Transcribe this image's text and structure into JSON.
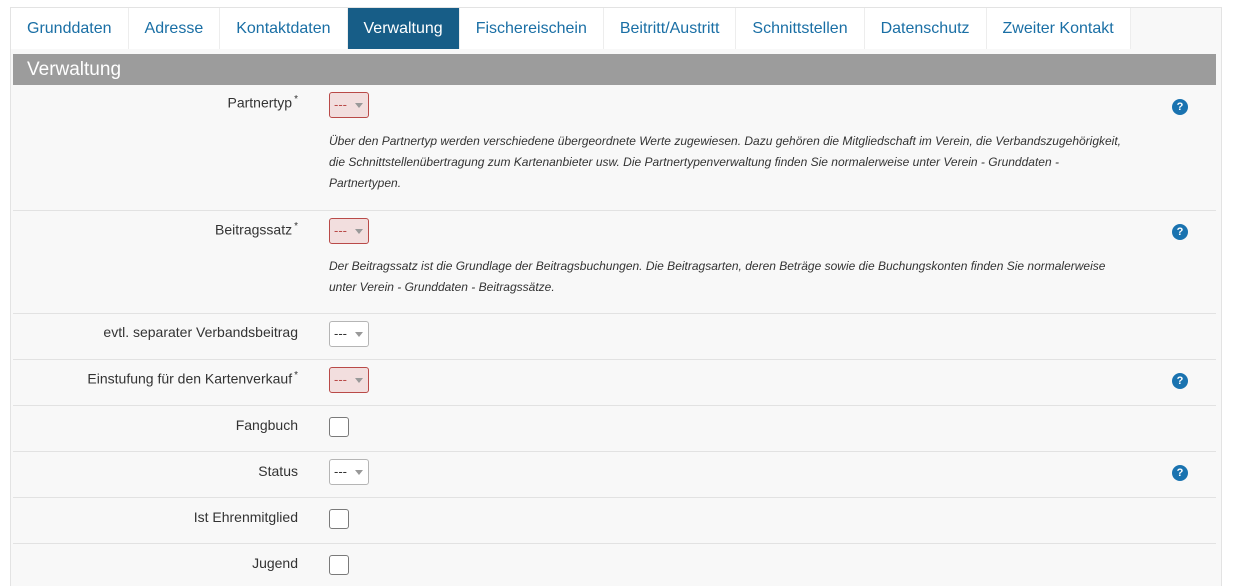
{
  "tabs": [
    {
      "label": "Grunddaten",
      "active": false
    },
    {
      "label": "Adresse",
      "active": false
    },
    {
      "label": "Kontaktdaten",
      "active": false
    },
    {
      "label": "Verwaltung",
      "active": true
    },
    {
      "label": "Fischereischein",
      "active": false
    },
    {
      "label": "Beitritt/Austritt",
      "active": false
    },
    {
      "label": "Schnittstellen",
      "active": false
    },
    {
      "label": "Datenschutz",
      "active": false
    },
    {
      "label": "Zweiter Kontakt",
      "active": false
    }
  ],
  "section": {
    "title": "Verwaltung"
  },
  "fields": {
    "partnertyp": {
      "label": "Partnertyp",
      "required": "*",
      "value": "---",
      "help_line1": "Über den Partnertyp werden verschiedene übergeordnete Werte zugewiesen. Dazu gehören die Mitgliedschaft im Verein, die Verbandszugehörigkeit,",
      "help_line2": "die Schnittstellenübertragung zum Kartenanbieter usw. Die Partnertypenverwaltung finden Sie normalerweise unter Verein - Grunddaten -",
      "help_line3": "Partnertypen.",
      "help_icon": "?"
    },
    "beitragssatz": {
      "label": "Beitragssatz",
      "required": "*",
      "value": "---",
      "help_line1": "Der Beitragssatz ist die Grundlage der Beitragsbuchungen. Die Beitragsarten, deren Beträge sowie die Buchungskonten finden Sie normalerweise",
      "help_line2": "unter Verein - Grunddaten - Beitragssätze.",
      "help_icon": "?"
    },
    "verbandsbeitrag": {
      "label": "evtl. separater Verbandsbeitrag",
      "value": "---"
    },
    "kartenverkauf": {
      "label": "Einstufung für den Kartenverkauf",
      "required": "*",
      "value": "---",
      "help_icon": "?"
    },
    "fangbuch": {
      "label": "Fangbuch"
    },
    "status": {
      "label": "Status",
      "value": "---",
      "help_icon": "?"
    },
    "ehrenmitglied": {
      "label": "Ist Ehrenmitglied"
    },
    "jugend": {
      "label": "Jugend"
    }
  },
  "colors": {
    "accent": "#175d87",
    "link": "#1a6fa5",
    "error": "#b94a48",
    "header": "#9c9c9c"
  }
}
